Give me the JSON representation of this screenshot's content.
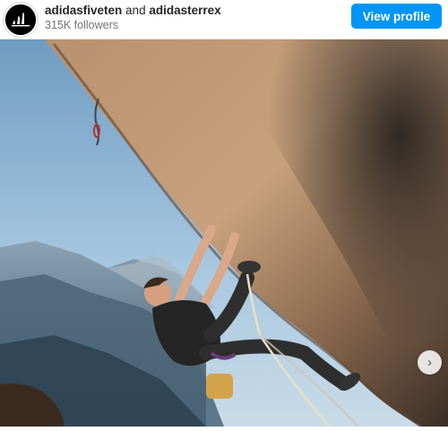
{
  "post": {
    "account_primary": "adidasfiveten",
    "joiner": "and",
    "account_secondary": "adidasterrex",
    "followers": "315K followers",
    "view_profile_label": "View profile"
  },
  "photo": {
    "subject": "rock climber on overhanging cliff",
    "next_icon": "chevron-right-icon"
  }
}
